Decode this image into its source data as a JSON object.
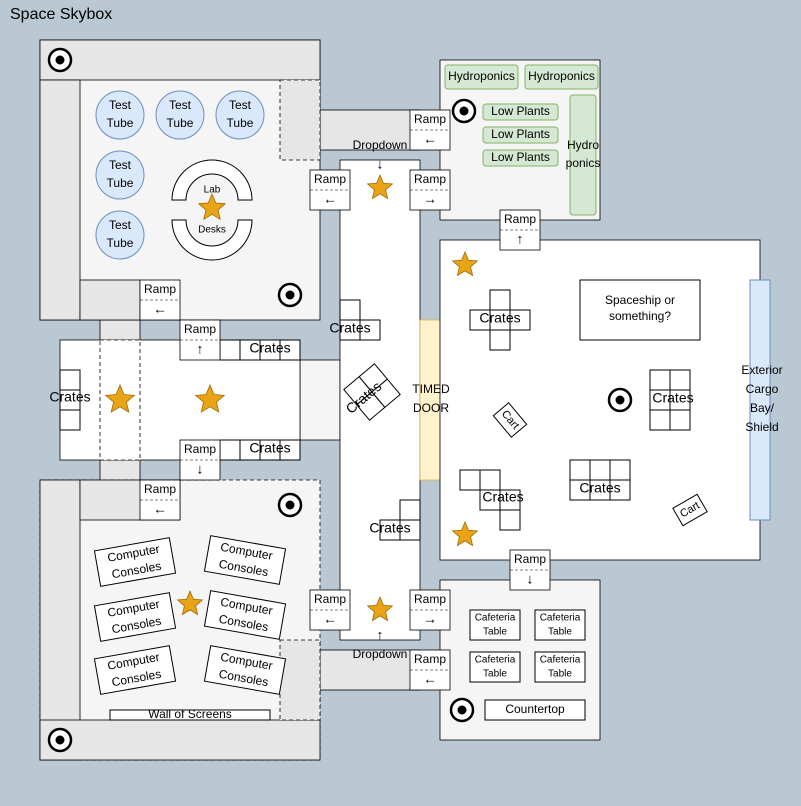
{
  "map": {
    "title": "Space Skybox",
    "labels": {
      "test_tube_word1": "Test",
      "test_tube_word2": "Tube",
      "lab": "Lab",
      "desks": "Desks",
      "ramp": "Ramp",
      "dropdown": "Dropdown",
      "crates": "Crates",
      "hydroponics": "Hydroponics",
      "low_plants": "Low Plants",
      "hydro_line1": "Hydro",
      "hydro_line2": "ponics",
      "timed_line1": "TIMED",
      "timed_line2": "DOOR",
      "spaceship_line1": "Spaceship or",
      "spaceship_line2": "something?",
      "exterior_lines": [
        "Exterior",
        "Cargo",
        "Bay/",
        "Shield"
      ],
      "cart": "Cart",
      "computer": "Computer",
      "consoles": "Consoles",
      "wall_of_screens": "Wall of Screens",
      "cafeteria": "Cafeteria",
      "table": "Table",
      "countertop": "Countertop"
    },
    "arrows": {
      "left": "←",
      "right": "→",
      "up": "↑",
      "down": "↓"
    },
    "colors": {
      "background": "#bac8d3",
      "room": "#f5f5f5",
      "corridor": "#e6e6e6",
      "tube": "#dae8fc",
      "tube_stroke": "#6c8ebf",
      "plant": "#d5e8d4",
      "plant_stroke": "#82b366",
      "timed_door": "#fff2cc",
      "star": "#e8a317"
    }
  }
}
